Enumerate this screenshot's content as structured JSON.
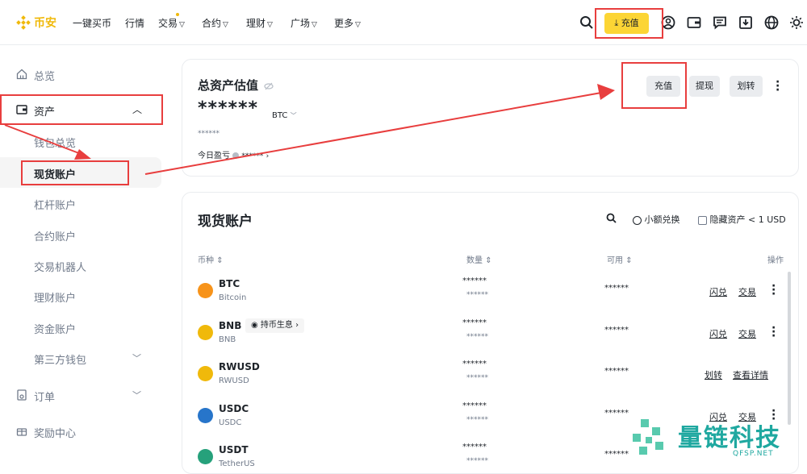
{
  "nav": {
    "brand": "币安",
    "items": [
      {
        "label": "一键买币",
        "chev": false
      },
      {
        "label": "行情",
        "chev": false
      },
      {
        "label": "交易",
        "chev": true
      },
      {
        "label": "合约",
        "chev": true
      },
      {
        "label": "理财",
        "chev": true
      },
      {
        "label": "广场",
        "chev": true
      },
      {
        "label": "更多",
        "chev": true
      }
    ],
    "deposit_label": "充值"
  },
  "sidebar": {
    "items": [
      {
        "label": "总览",
        "icon": "home-icon"
      },
      {
        "label": "资产",
        "icon": "wallet-icon"
      },
      {
        "label": "钱包总览"
      },
      {
        "label": "现货账户"
      },
      {
        "label": "杠杆账户"
      },
      {
        "label": "合约账户"
      },
      {
        "label": "交易机器人"
      },
      {
        "label": "理财账户"
      },
      {
        "label": "资金账户"
      },
      {
        "label": "第三方钱包"
      },
      {
        "label": "订单",
        "icon": "order-icon"
      },
      {
        "label": "奖励中心",
        "icon": "gift-icon"
      }
    ]
  },
  "overview": {
    "title": "总资产估值",
    "masked_value": "******",
    "unit": "BTC",
    "masked_small": "******",
    "pnl_label": "今日盈亏",
    "pnl_value": "******",
    "buttons": {
      "deposit": "充值",
      "withdraw": "提现",
      "transfer": "划转"
    }
  },
  "spot": {
    "title": "现货账户",
    "small_convert": "小额兑换",
    "hide_assets": "隐藏资产 < 1 USD",
    "headers": {
      "coin": "币种",
      "amount": "数量",
      "available": "可用",
      "action": "操作"
    },
    "rows": [
      {
        "symbol": "BTC",
        "name": "Bitcoin",
        "amount": "******",
        "amount_sub": "******",
        "available": "******",
        "act1": "闪兑",
        "act2": "交易",
        "color": "#f7931a",
        "badge": ""
      },
      {
        "symbol": "BNB",
        "name": "BNB",
        "amount": "******",
        "amount_sub": "******",
        "available": "******",
        "act1": "闪兑",
        "act2": "交易",
        "color": "#f0b90b",
        "badge": "持币生息"
      },
      {
        "symbol": "RWUSD",
        "name": "RWUSD",
        "amount": "******",
        "amount_sub": "******",
        "available": "******",
        "act1": "划转",
        "act2": "查看详情",
        "color": "#f0b90b",
        "badge": ""
      },
      {
        "symbol": "USDC",
        "name": "USDC",
        "amount": "******",
        "amount_sub": "******",
        "available": "******",
        "act1": "闪兑",
        "act2": "交易",
        "color": "#2775ca",
        "badge": ""
      },
      {
        "symbol": "USDT",
        "name": "TetherUS",
        "amount": "******",
        "amount_sub": "******",
        "available": "******",
        "act1": "",
        "act2": "",
        "color": "#26a17b",
        "badge": ""
      }
    ]
  },
  "watermark": {
    "text": "量链科技",
    "sub": "QFSP.NET"
  },
  "colors": {
    "brand": "#f0b90b",
    "accent": "#fcd535",
    "annotation": "#e83e3e"
  }
}
